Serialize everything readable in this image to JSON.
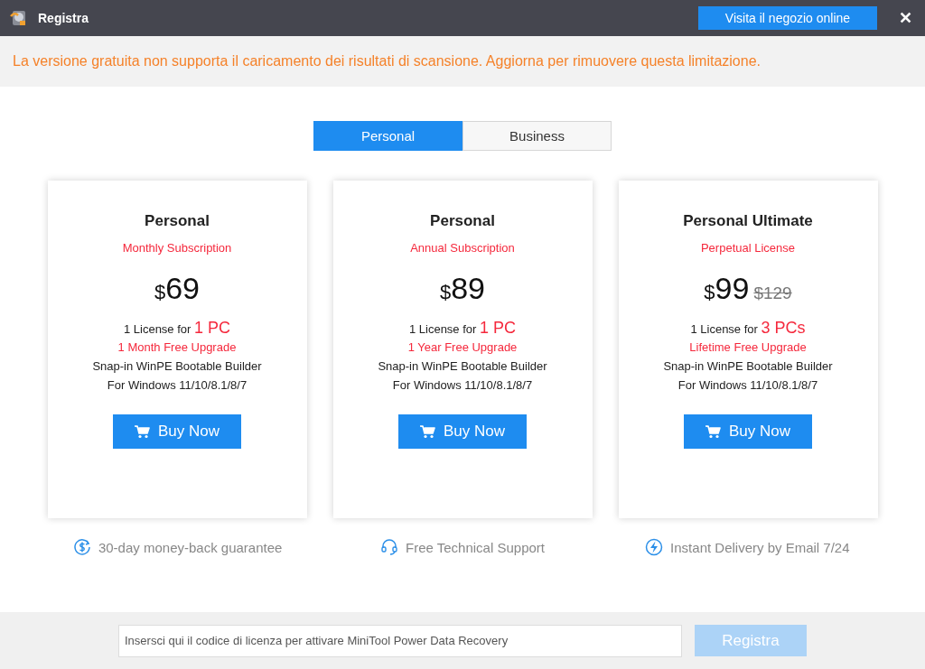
{
  "window": {
    "title": "Registra",
    "store_button": "Visita il negozio online",
    "close": "✕"
  },
  "notice": "La versione gratuita non supporta il caricamento dei risultati di scansione. Aggiorna per rimuovere questa limitazione.",
  "tabs": [
    {
      "label": "Personal",
      "selected": true
    },
    {
      "label": "Business",
      "selected": false
    }
  ],
  "plans": [
    {
      "title": "Personal",
      "subtitle": "Monthly Subscription",
      "currency": "$",
      "price": "69",
      "license_prefix": "1 License for",
      "license_count": "1 PC",
      "upgrade": "1 Month Free Upgrade",
      "features": [
        "Snap-in WinPE Bootable Builder",
        "For Windows 11/10/8.1/8/7"
      ],
      "button": "Buy Now"
    },
    {
      "title": "Personal",
      "subtitle": "Annual Subscription",
      "currency": "$",
      "price": "89",
      "license_prefix": "1 License for",
      "license_count": "1 PC",
      "upgrade": "1 Year Free Upgrade",
      "features": [
        "Snap-in WinPE Bootable Builder",
        "For Windows 11/10/8.1/8/7"
      ],
      "button": "Buy Now"
    },
    {
      "title": "Personal Ultimate",
      "subtitle": "Perpetual License",
      "currency": "$",
      "price": "99",
      "old_price": "$129",
      "license_prefix": "1 License for",
      "license_count": "3 PCs",
      "upgrade": "Lifetime Free Upgrade",
      "features": [
        "Snap-in WinPE Bootable Builder",
        "For Windows 11/10/8.1/8/7"
      ],
      "button": "Buy Now"
    }
  ],
  "guarantees": [
    {
      "kind": "money",
      "label": "30-day money-back guarantee"
    },
    {
      "kind": "support",
      "label": "Free Technical Support"
    },
    {
      "kind": "delivery",
      "label": "Instant Delivery by Email 7/24"
    }
  ],
  "footer": {
    "placeholder": "Insersci qui il codice di licenza per attivare MiniTool Power Data Recovery",
    "button": "Registra",
    "disabled": true
  }
}
